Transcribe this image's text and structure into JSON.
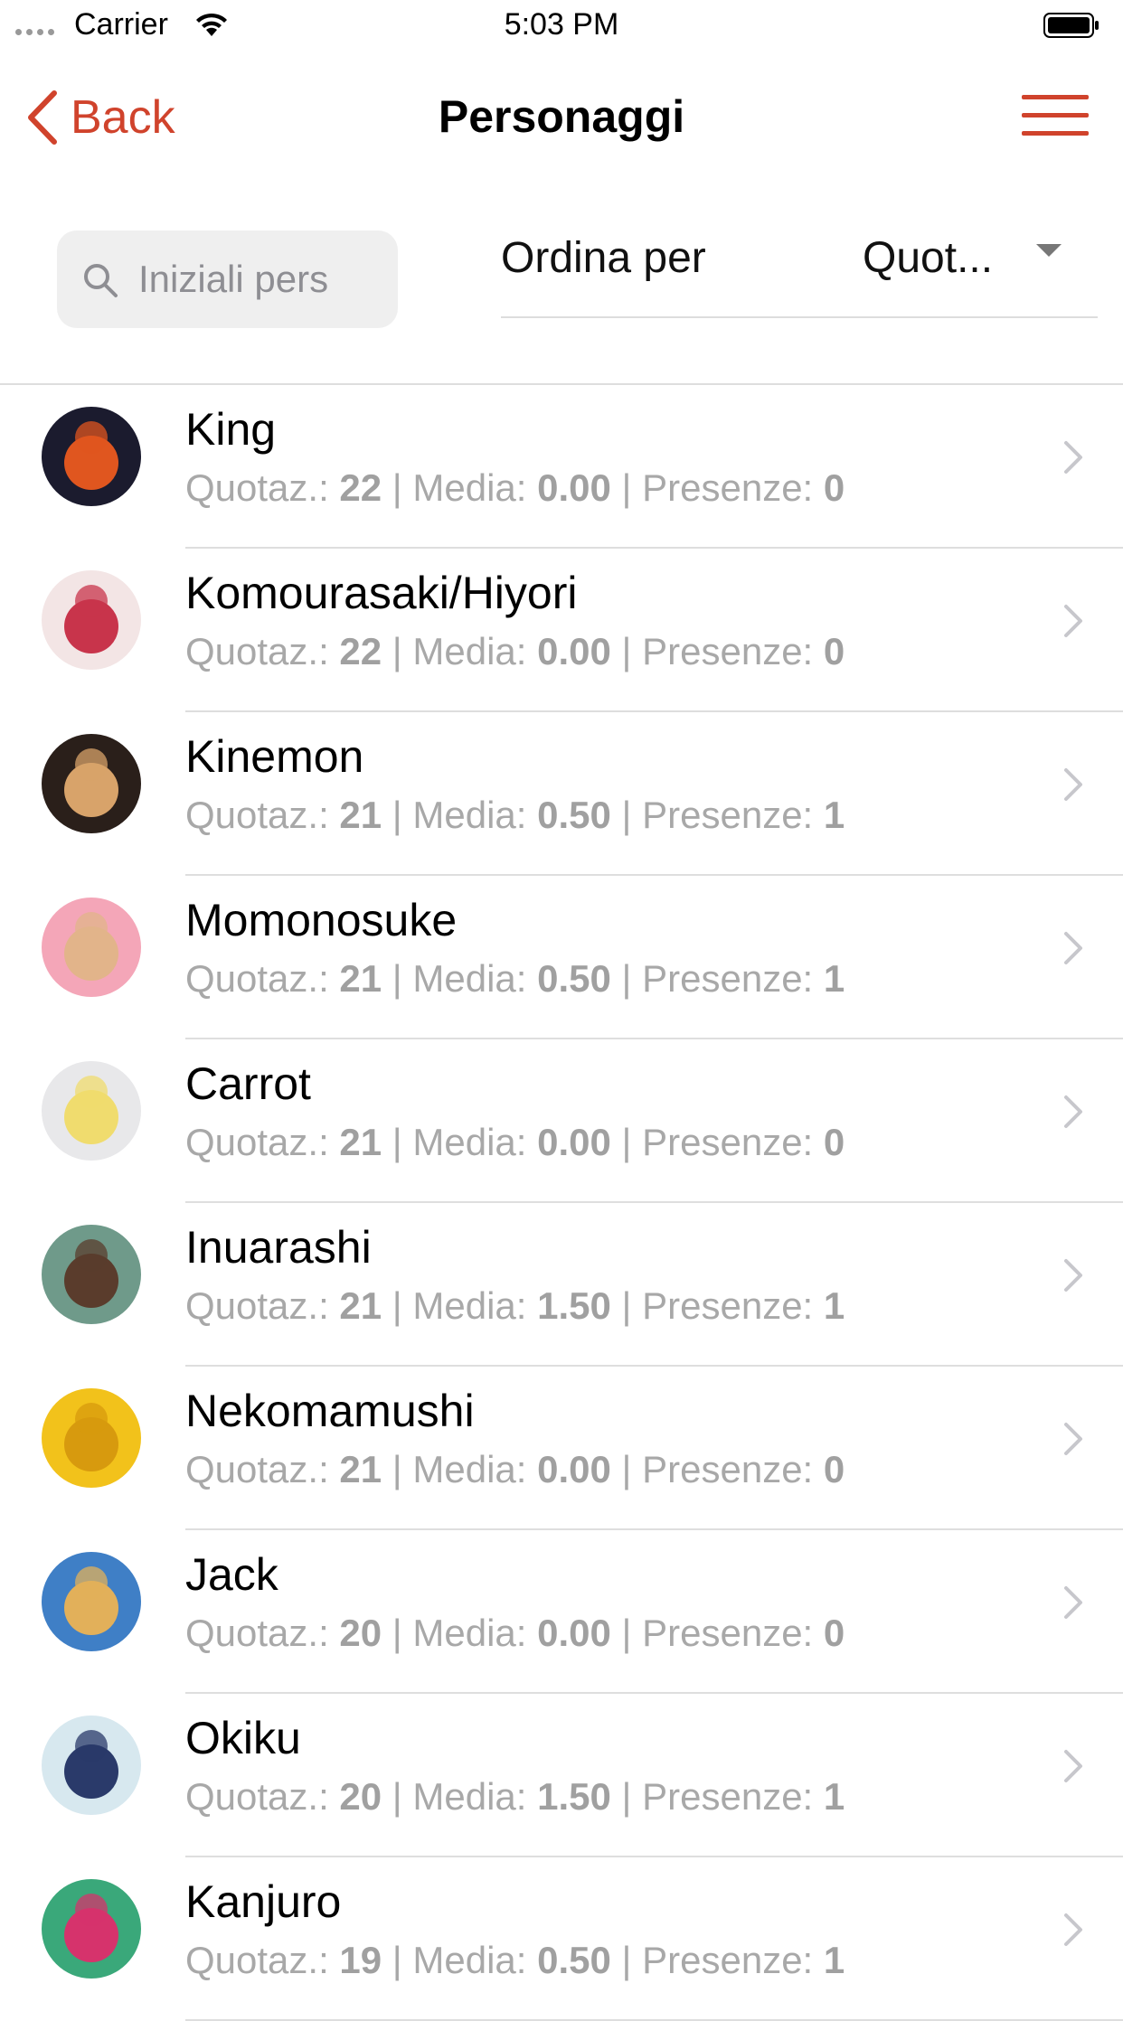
{
  "status_bar": {
    "carrier": "Carrier",
    "time": "5:03 PM"
  },
  "nav": {
    "back_label": "Back",
    "title": "Personaggi"
  },
  "filters": {
    "search_placeholder": "Iniziali pers",
    "sort_label": "Ordina per",
    "sort_value": "Quot..."
  },
  "labels": {
    "quotaz": "Quotaz.: ",
    "media": " | Media: ",
    "presenze": " | Presenze: "
  },
  "colors": {
    "accent": "#d0432c",
    "secondary_text": "#a8a8a8",
    "separator": "#dedede"
  },
  "characters": [
    {
      "name": "King",
      "quotaz": "22",
      "media": "0.00",
      "presenze": "0",
      "avatar_bg": "#1b1b2e",
      "avatar_fg": "#e0561f"
    },
    {
      "name": "Komourasaki/Hiyori",
      "quotaz": "22",
      "media": "0.00",
      "presenze": "0",
      "avatar_bg": "#f3e5e5",
      "avatar_fg": "#c8344b"
    },
    {
      "name": "Kinemon",
      "quotaz": "21",
      "media": "0.50",
      "presenze": "1",
      "avatar_bg": "#2a1f1a",
      "avatar_fg": "#d8a36a"
    },
    {
      "name": "Momonosuke",
      "quotaz": "21",
      "media": "0.50",
      "presenze": "1",
      "avatar_bg": "#f4a6b8",
      "avatar_fg": "#e2b48a"
    },
    {
      "name": "Carrot",
      "quotaz": "21",
      "media": "0.00",
      "presenze": "0",
      "avatar_bg": "#e8e8ea",
      "avatar_fg": "#f0dc6e"
    },
    {
      "name": "Inuarashi",
      "quotaz": "21",
      "media": "1.50",
      "presenze": "1",
      "avatar_bg": "#6f9a8a",
      "avatar_fg": "#5a3c2c"
    },
    {
      "name": "Nekomamushi",
      "quotaz": "21",
      "media": "0.00",
      "presenze": "0",
      "avatar_bg": "#f2c21b",
      "avatar_fg": "#d79a0e"
    },
    {
      "name": "Jack",
      "quotaz": "20",
      "media": "0.00",
      "presenze": "0",
      "avatar_bg": "#3f7fc6",
      "avatar_fg": "#e2b05a"
    },
    {
      "name": "Okiku",
      "quotaz": "20",
      "media": "1.50",
      "presenze": "1",
      "avatar_bg": "#d7e8ef",
      "avatar_fg": "#2a3a6a"
    },
    {
      "name": "Kanjuro",
      "quotaz": "19",
      "media": "0.50",
      "presenze": "1",
      "avatar_bg": "#3aa87a",
      "avatar_fg": "#d6336c"
    }
  ]
}
